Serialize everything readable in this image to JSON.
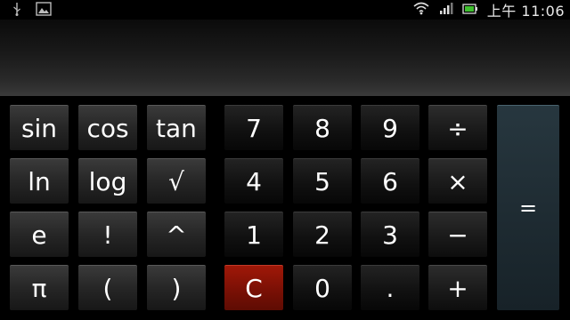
{
  "status_bar": {
    "left_icons": [
      "usb-icon",
      "image-icon"
    ],
    "right_icons": [
      "wifi-icon",
      "signal-icon",
      "battery-icon"
    ],
    "time": "上午 11:06"
  },
  "display": {
    "value": ""
  },
  "keys": {
    "sin": "sin",
    "cos": "cos",
    "tan": "tan",
    "ln": "ln",
    "log": "log",
    "sqrt": "√",
    "e": "e",
    "factorial": "!",
    "power": "^",
    "pi": "π",
    "lparen": "(",
    "rparen": ")",
    "n7": "7",
    "n8": "8",
    "n9": "9",
    "n4": "4",
    "n5": "5",
    "n6": "6",
    "n1": "1",
    "n2": "2",
    "n3": "3",
    "clear": "C",
    "n0": "0",
    "dot": ".",
    "divide": "÷",
    "multiply": "×",
    "minus": "−",
    "plus": "+",
    "equals": "="
  }
}
